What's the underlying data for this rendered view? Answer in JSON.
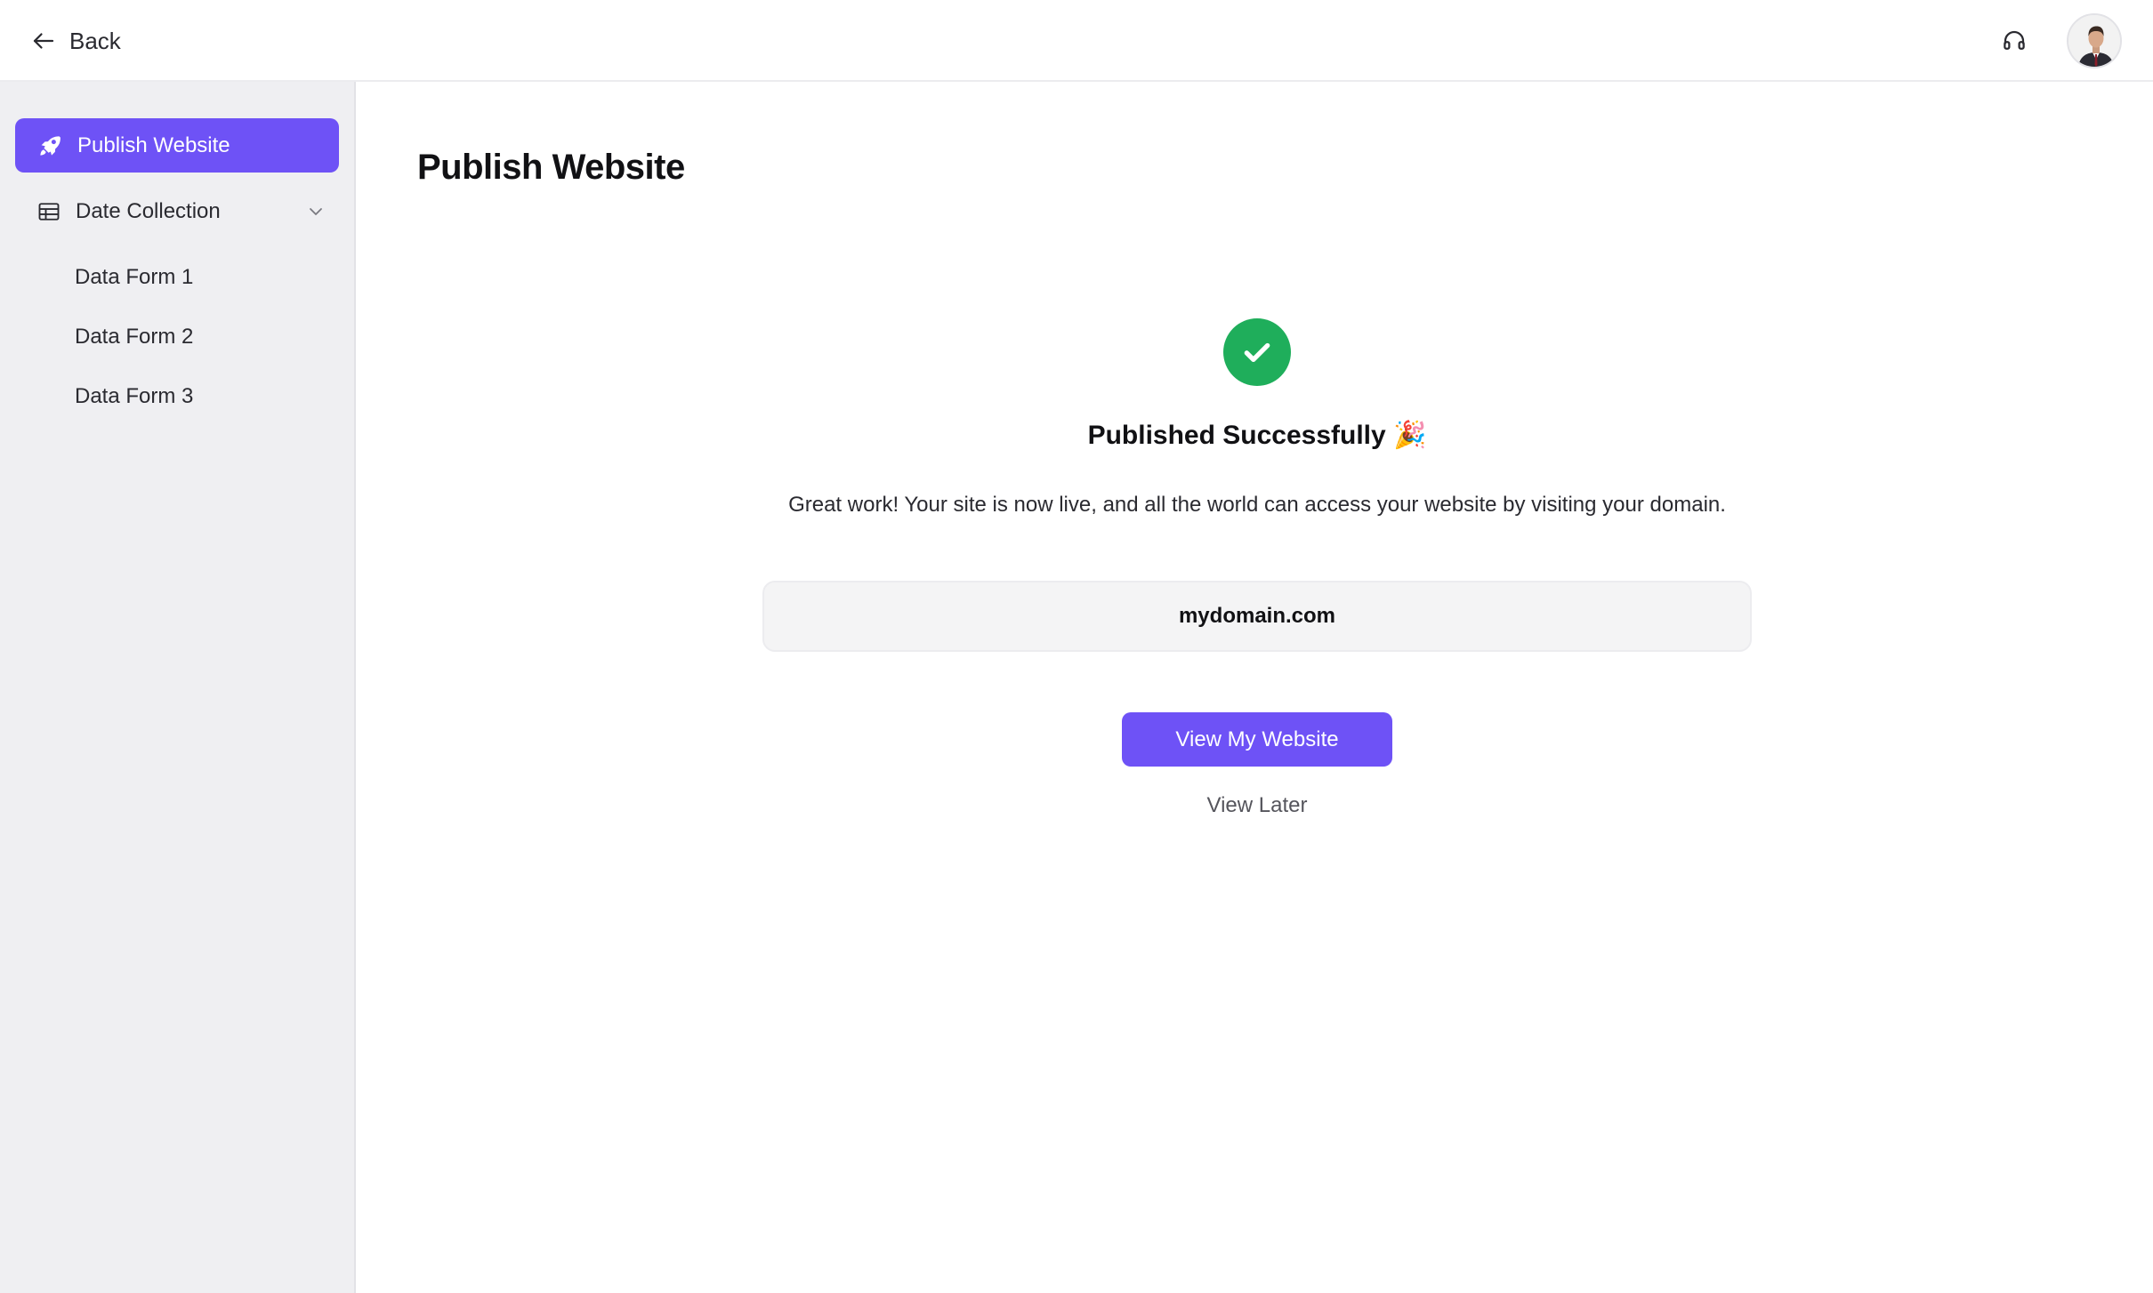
{
  "topbar": {
    "back_label": "Back",
    "icons": {
      "back": "arrow-left-icon",
      "support": "headphones-icon",
      "avatar": "user-avatar"
    }
  },
  "sidebar": {
    "active_item": {
      "label": "Publish Website",
      "icon": "rocket-icon"
    },
    "group": {
      "label": "Date Collection",
      "icon": "table-icon",
      "expanded": true
    },
    "sub_items": [
      {
        "label": "Data Form 1"
      },
      {
        "label": "Data Form 2"
      },
      {
        "label": "Data Form 3"
      }
    ]
  },
  "main": {
    "title": "Publish Website",
    "success": {
      "icon": "check-circle-icon",
      "title": "Published Successfully",
      "emoji": "🎉",
      "message": "Great work! Your site is now live, and all the world can access your website by visiting your domain."
    },
    "domain": "mydomain.com",
    "primary_button": "View My Website",
    "secondary_button": "View Later"
  },
  "colors": {
    "accent": "#6e52f6",
    "success": "#1fae5b",
    "sidebar_bg": "#efeff2"
  }
}
